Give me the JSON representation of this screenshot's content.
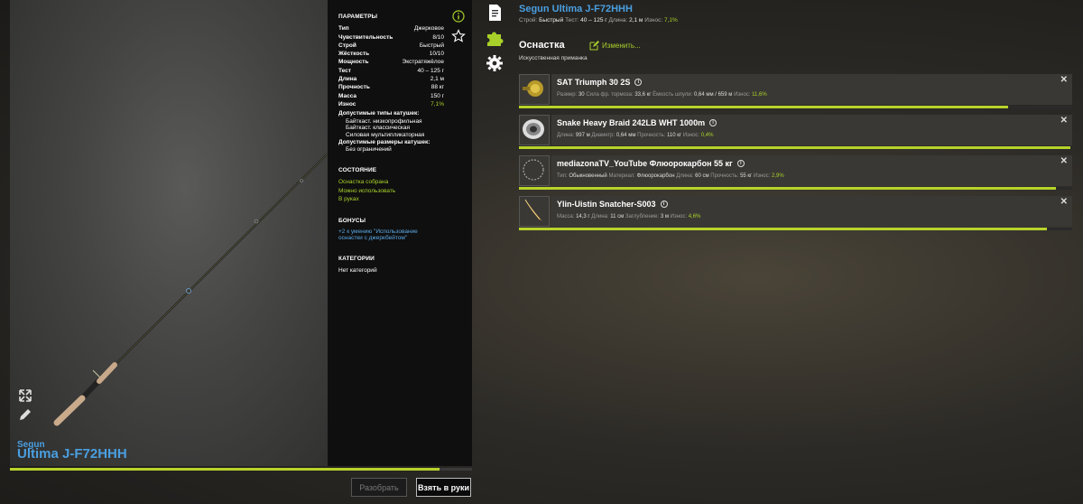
{
  "rod": {
    "brand": "Segun",
    "model": "Ultima J-F72HHH"
  },
  "params": {
    "heading": "ПАРАМЕТРЫ",
    "rows": [
      {
        "label": "Тип",
        "value": "Джерковое"
      },
      {
        "label": "Чувствительность",
        "value": "8/10"
      },
      {
        "label": "Строй",
        "value": "Быстрый"
      },
      {
        "label": "Жёсткость",
        "value": "10/10"
      },
      {
        "label": "Мощность",
        "value": "Экстратяжёлое"
      },
      {
        "label": "Тест",
        "value": "40 – 125 г"
      },
      {
        "label": "Длина",
        "value": "2,1 м"
      },
      {
        "label": "Прочность",
        "value": "88 кг"
      },
      {
        "label": "Масса",
        "value": "150 г"
      },
      {
        "label": "Износ",
        "value": "7,1%"
      }
    ],
    "reel_types_label": "Допустимые типы катушек:",
    "reel_types": [
      "Байткаст. низкопрофильная",
      "Байткаст. классическая",
      "Силовая мультипликаторная"
    ],
    "reel_sizes_label": "Допустимые размеры катушек:",
    "reel_sizes": [
      "Без ограничений"
    ],
    "state_heading": "СОСТОЯНИЕ",
    "state": [
      "Оснастка собрана",
      "Можно использовать",
      "В руках"
    ],
    "bonus_heading": "БОНУСЫ",
    "bonus": [
      "+2 к умению \"Использование",
      "оснастки с джеркбейтом\""
    ],
    "category_heading": "КАТЕГОРИИ",
    "category": "Нет категорий"
  },
  "buttons": {
    "disassemble": "Разобрать",
    "take": "Взять в руки"
  },
  "wear_progress": 0.929,
  "header": {
    "title": "Segun Ultima J-F72HHH",
    "sub": [
      {
        "k": "Строй:",
        "v": "Быстрый"
      },
      {
        "k": "Тест:",
        "v": "40 – 125 г"
      },
      {
        "k": "Длина:",
        "v": "2,1 м"
      },
      {
        "k": "Износ:",
        "v": "7,1%"
      }
    ]
  },
  "tackle": {
    "heading": "Оснастка",
    "edit": "Изменить...",
    "lure_type": "Искусственная приманка",
    "items": [
      {
        "name": "SAT Triumph 30 2S",
        "icon": "reel-icon",
        "meta": [
          {
            "k": "Размер:",
            "v": "30"
          },
          {
            "k": "Сила фр. тормоза:",
            "v": "33,6 кг"
          },
          {
            "k": "Ёмкость шпули:",
            "v": "0,64 мм / 659 м"
          },
          {
            "k": "Износ:",
            "v": "11,6%"
          }
        ],
        "fill": 0.884
      },
      {
        "name": "Snake Heavy Braid 242LB WHT 1000m",
        "icon": "line-spool-icon",
        "meta": [
          {
            "k": "Длина:",
            "v": "997 м"
          },
          {
            "k": "Диаметр:",
            "v": "0,64 мм"
          },
          {
            "k": "Прочность:",
            "v": "110 кг"
          },
          {
            "k": "Износ:",
            "v": "0,4%"
          }
        ],
        "fill": 0.996
      },
      {
        "name": "mediazonaTV_YouTube Флюорокарбон 55 кг",
        "icon": "leader-icon",
        "meta": [
          {
            "k": "Тип:",
            "v": "Обыкновенный"
          },
          {
            "k": "Материал:",
            "v": "Флюорокарбон"
          },
          {
            "k": "Длина:",
            "v": "60 см"
          },
          {
            "k": "Прочность:",
            "v": "55 кг"
          },
          {
            "k": "Износ:",
            "v": "2,9%"
          }
        ],
        "fill": 0.971
      },
      {
        "name": "Ylin-Uistin Snatcher-S003",
        "icon": "lure-icon",
        "meta": [
          {
            "k": "Масса:",
            "v": "14,3 г"
          },
          {
            "k": "Длина:",
            "v": "11 см"
          },
          {
            "k": "Заглубление:",
            "v": "3 м"
          },
          {
            "k": "Износ:",
            "v": "4,6%"
          }
        ],
        "fill": 0.954
      }
    ]
  },
  "colors": {
    "accent_green": "#a8d02a",
    "accent_blue": "#4a9fe0"
  }
}
